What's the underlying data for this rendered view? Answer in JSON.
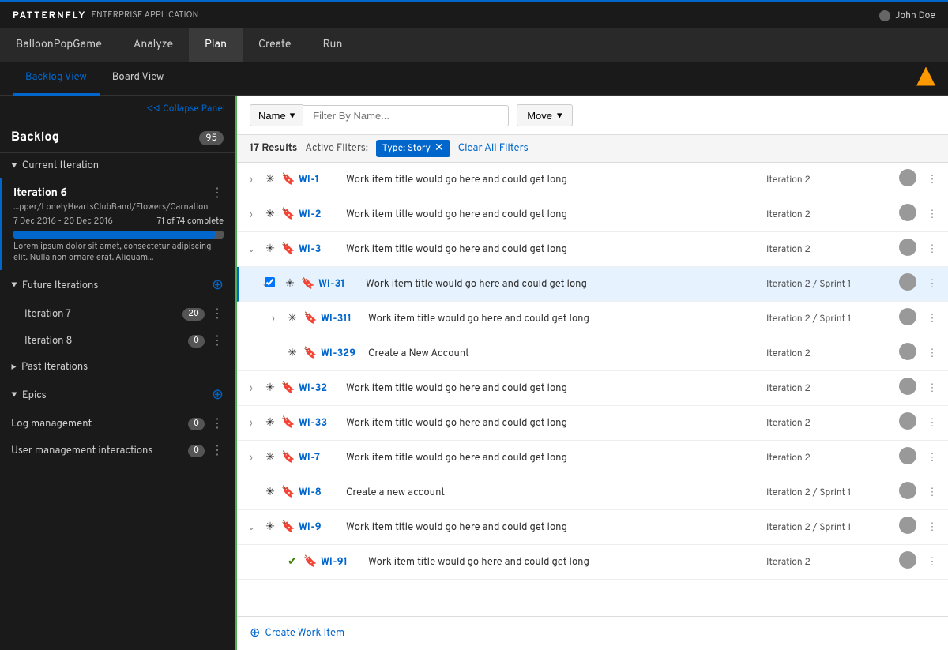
{
  "topbar": {
    "brand_logo": "PATTERNFLY",
    "brand_app": "ENTERPRISE APPLICATION",
    "user_name": "John Doe"
  },
  "nav": {
    "items": [
      {
        "label": "BalloonPopGame",
        "active": false
      },
      {
        "label": "Analyze",
        "active": false
      },
      {
        "label": "Plan",
        "active": true
      },
      {
        "label": "Create",
        "active": false
      },
      {
        "label": "Run",
        "active": false
      }
    ]
  },
  "subnav": {
    "tabs": [
      {
        "label": "Backlog View",
        "active": true
      },
      {
        "label": "Board View",
        "active": false
      }
    ]
  },
  "sidebar": {
    "collapse_label": "Collapse Panel",
    "backlog_label": "Backlog",
    "backlog_count": "95",
    "current_iteration": {
      "label": "Current Iteration",
      "name": "Iteration 6",
      "path": "...pper/LonelyHeartsClubBand/Flowers/Carnation",
      "dates": "7 Dec 2016 - 20 Dec 2016",
      "complete": "71 of 74 complete",
      "progress": 96,
      "description": "Lorem ipsum dolor sit amet, consectetur adipiscing elit. Nulla non ornare erat. Aliquam..."
    },
    "future_iterations": {
      "label": "Future Iterations",
      "items": [
        {
          "name": "Iteration 7",
          "count": "20"
        },
        {
          "name": "Iteration 8",
          "count": "0"
        }
      ]
    },
    "past_iterations": {
      "label": "Past Iterations"
    },
    "epics": {
      "label": "Epics",
      "items": [
        {
          "name": "Log management",
          "count": "0"
        },
        {
          "name": "User management interactions",
          "count": "0"
        }
      ]
    }
  },
  "toolbar": {
    "filter_name_label": "Name",
    "filter_placeholder": "Filter By Name...",
    "move_label": "Move"
  },
  "results": {
    "count": "17 Results",
    "active_filters_label": "Active Filters:",
    "filter_badge": "Type: Story",
    "clear_filters_label": "Clear All Filters"
  },
  "work_items": [
    {
      "id": "WI-1",
      "title": "Work item title would go here and could get long",
      "iteration": "Iteration 2",
      "expand": ">",
      "type": "asterisk",
      "has_bookmark": true,
      "indent": false,
      "checked": false,
      "highlighted": false
    },
    {
      "id": "WI-2",
      "title": "Work item title would go here and could get long",
      "iteration": "Iteration 2",
      "expand": ">",
      "type": "asterisk",
      "has_bookmark": true,
      "indent": false,
      "checked": false,
      "highlighted": false
    },
    {
      "id": "WI-3",
      "title": "Work item title would go here and could get long",
      "iteration": "Iteration 2",
      "expand": "v",
      "type": "asterisk",
      "has_bookmark": true,
      "indent": false,
      "checked": false,
      "highlighted": false
    },
    {
      "id": "WI-31",
      "title": "Work item title would go here and could get long",
      "iteration": "Iteration 2 / Sprint 1",
      "expand": "v",
      "type": "asterisk",
      "has_bookmark": true,
      "indent": true,
      "checked": true,
      "highlighted": true
    },
    {
      "id": "WI-311",
      "title": "Work item title would go here and could get long",
      "iteration": "Iteration 2 / Sprint 1",
      "expand": ">",
      "type": "asterisk",
      "has_bookmark": true,
      "indent": true,
      "checked": false,
      "highlighted": false
    },
    {
      "id": "WI-329",
      "title": "Create a New Account",
      "iteration": "Iteration 2",
      "expand": "",
      "type": "asterisk",
      "has_bookmark": true,
      "indent": true,
      "checked": false,
      "highlighted": false
    },
    {
      "id": "WI-32",
      "title": "Work item title would go here and could get long",
      "iteration": "Iteration 2",
      "expand": ">",
      "type": "asterisk",
      "has_bookmark": true,
      "indent": false,
      "checked": false,
      "highlighted": false
    },
    {
      "id": "WI-33",
      "title": "Work item title would go here and could get long",
      "iteration": "Iteration 2",
      "expand": ">",
      "type": "asterisk",
      "has_bookmark": true,
      "indent": false,
      "checked": false,
      "highlighted": false
    },
    {
      "id": "WI-7",
      "title": "Work item title would go here and could get long",
      "iteration": "Iteration 2",
      "expand": ">",
      "type": "asterisk",
      "has_bookmark": true,
      "indent": false,
      "checked": false,
      "highlighted": false
    },
    {
      "id": "WI-8",
      "title": "Create a new account",
      "iteration": "Iteration 2 / Sprint 1",
      "expand": "",
      "type": "asterisk",
      "has_bookmark": true,
      "indent": false,
      "checked": false,
      "highlighted": false
    },
    {
      "id": "WI-9",
      "title": "Work item title would go here and could get long",
      "iteration": "Iteration 2 / Sprint 1",
      "expand": "v",
      "type": "asterisk",
      "has_bookmark": true,
      "indent": false,
      "checked": false,
      "highlighted": false
    },
    {
      "id": "WI-91",
      "title": "Work item title would go here and could get long",
      "iteration": "Iteration 2",
      "expand": "",
      "type": "check",
      "has_bookmark": true,
      "indent": true,
      "checked": false,
      "highlighted": false
    }
  ],
  "footer": {
    "create_label": "Create Work Item"
  }
}
